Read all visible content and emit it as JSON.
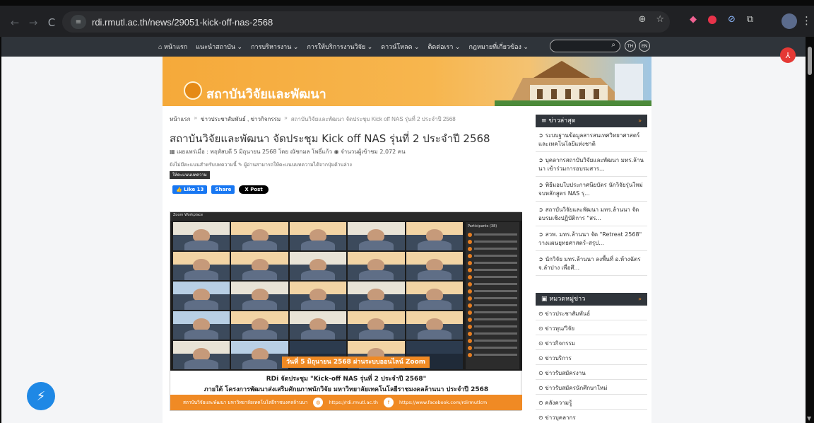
{
  "browser": {
    "url": "rdi.rmutl.ac.th/news/29051-kick-off-nas-2568",
    "back_icon": "←",
    "forward_icon": "→",
    "reload_icon": "C",
    "site_info_icon": "≡",
    "zoom_icon": "⊕",
    "star_icon": "☆",
    "menu_icon": "⋮"
  },
  "nav": {
    "items": [
      "หน้าแรก",
      "แนะนำสถาบัน",
      "การบริหารงาน",
      "การให้บริการงานวิจัย",
      "ดาวน์โหลด",
      "ติดต่อเรา",
      "กฎหมายที่เกี่ยวข้อง"
    ],
    "search_icon": "⌕",
    "lang_th": "TH",
    "lang_en": "EN"
  },
  "banner": {
    "title": "สถาบันวิจัยและพัฒนา"
  },
  "breadcrumb": {
    "home": "หน้าแรก",
    "sep": "»",
    "category": "ข่าวประชาสัมพันธ์ , ข่าวกิจกรรม",
    "current": "สถาบันวิจัยและพัฒนา จัดประชุม Kick off NAS รุ่นที่ 2 ประจำปี 2568"
  },
  "post": {
    "title": "สถาบันวิจัยและพัฒนา จัดประชุม Kick off NAS รุ่นที่ 2 ประจำปี 2568",
    "meta": "เผยแพร่เมื่อ : พฤหัสบดี 5 มิถุนายน 2568 โดย ณัชกมล โพธิ์แก้ว  ◉ จำนวนผู้เข้าชม 2,072 คน",
    "no_rating": "ยังไม่มีคะแนนสำหรับบทความนี้ ✎ ผู้อ่านสามารถให้คะแนนบทความได้จากปุ่มด้านล่าง",
    "rate_label": "ให้คะแนนบทความ",
    "like_label": "Like 13",
    "share_label": "Share",
    "xpost_label": "X Post"
  },
  "photo": {
    "zoom_title": "Zoom Workplace",
    "participants_label": "Participants (38)",
    "caption_bar": "วันที่ 5 มิถุนายน 2568 ผ่านระบบออนไลน์ Zoom",
    "line1": "RDi จัดประชุม \"Kick-off NAS รุ่นที่ 2 ประจำปี 2568\"",
    "line2": "ภายใต้  โครงการพัฒนาส่งเสริมศักยภาพนักวิจัย มหาวิทยาลัยเทคโนโลยีราชมงคลล้านนา ประจำปี 2568",
    "strip_org": "สถาบันวิจัยและพัฒนา มหาวิทยาลัยเทคโนโลยีราชมงคลล้านนา",
    "strip_web": "https://rdi.rmutl.ac.th",
    "strip_fb": "https://www.facebook.com/rdirmutlcm"
  },
  "sidebar": {
    "latest_title": "ข่าวล่าสุด",
    "latest": [
      "ระบบฐานข้อมูลสารสนเทศวิทยาศาสตร์และเทคโนโลยีแห่งชาติ",
      "บุคลากรสถาบันวิจัยและพัฒนา มทร.ล้านนา เข้าร่วมการอบรมสาร...",
      "พิธีมอบใบประกาศนียบัตร นักวิจัยรุ่นใหม่จบหลักสูตร NAS รุ...",
      "สถาบันวิจัยและพัฒนา มทร.ล้านนา จัดอบรมเชิงปฏิบัติการ \"สร...",
      "สวพ. มทร.ล้านนา จัด \"Retreat 2568\" วางแผนยุทธศาสตร์–สรุป...",
      "นักวิจัย มทร.ล้านนา ลงพื้นที่ อ.ห้างฉัตร จ.ลำปาง เพื่อศึ..."
    ],
    "categories_title": "หมวดหมู่ข่าว",
    "categories": [
      "ข่าวประชาสัมพันธ์",
      "ข่าวทุน/วิจัย",
      "ข่าวกิจกรรม",
      "ข่าวบริการ",
      "ข่าวรับสมัครงาน",
      "ข่าวรับสมัครนักศึกษาใหม่",
      "คลังความรู้",
      "ข่าวบุคลากร"
    ]
  }
}
